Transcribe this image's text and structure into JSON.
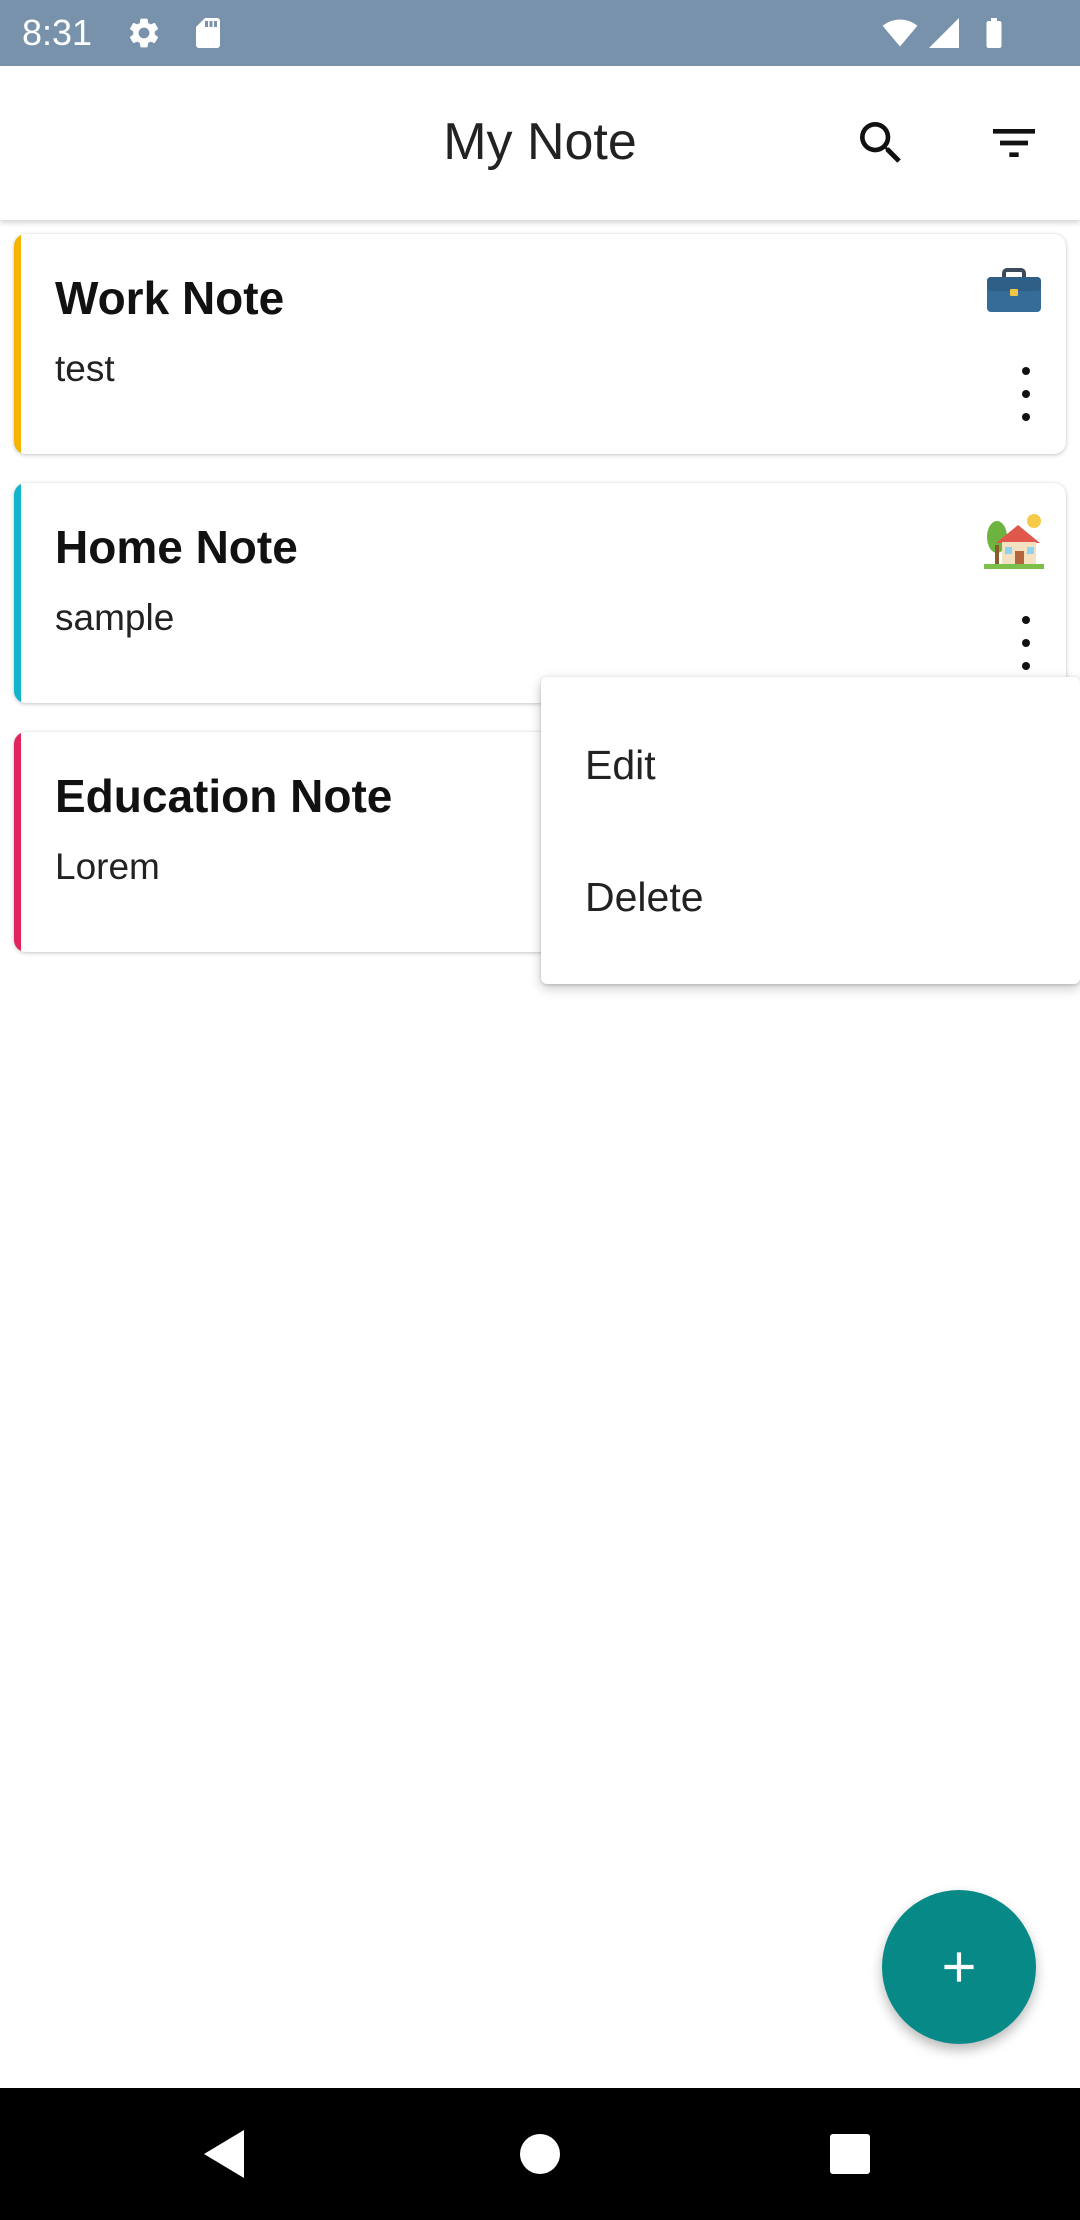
{
  "status_bar": {
    "time": "8:31",
    "icons": [
      "settings-icon",
      "sd-card-icon",
      "wifi-icon",
      "signal-icon",
      "battery-icon"
    ],
    "background": "#7892ab"
  },
  "app_bar": {
    "title": "My Note",
    "icons": [
      "search-icon",
      "filter-icon"
    ]
  },
  "notes": [
    {
      "title": "Work Note",
      "body": "test",
      "stripe_color": "#f4b400",
      "emoji": "briefcase-icon"
    },
    {
      "title": "Home Note",
      "body": "sample",
      "stripe_color": "#12b5cb",
      "emoji": "house-with-garden-icon"
    },
    {
      "title": "Education Note",
      "body": "Lorem",
      "stripe_color": "#e0245e",
      "emoji": ""
    }
  ],
  "popup_menu": {
    "items": [
      "Edit",
      "Delete"
    ]
  },
  "fab": {
    "icon": "plus-icon",
    "color": "#078a87"
  },
  "nav_bar": {
    "icons": [
      "back-icon",
      "home-icon",
      "recents-icon"
    ]
  }
}
